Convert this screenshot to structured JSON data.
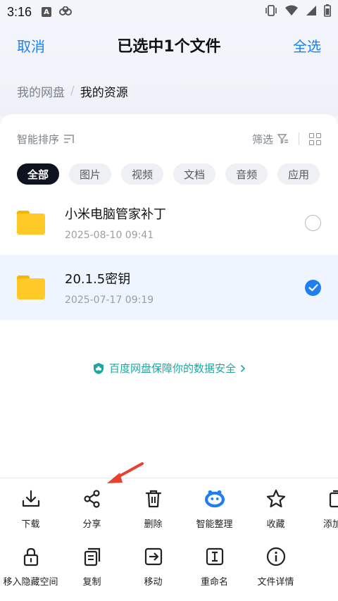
{
  "status": {
    "time": "3:16"
  },
  "header": {
    "cancel": "取消",
    "title": "已选中1个文件",
    "select_all": "全选"
  },
  "breadcrumb": {
    "root": "我的网盘",
    "separator": "/",
    "current": "我的资源"
  },
  "sort": {
    "label": "智能排序",
    "filter_label": "筛选"
  },
  "chips": [
    "全部",
    "图片",
    "视频",
    "文档",
    "音频",
    "应用"
  ],
  "files": [
    {
      "name": "小米电脑管家补丁",
      "date": "2025-08-10  09:41",
      "selected": false
    },
    {
      "name": "20.1.5密钥",
      "date": "2025-07-17  09:19",
      "selected": true
    }
  ],
  "security_tip": "百度网盘保障你的数据安全",
  "actions_row1": [
    "下载",
    "分享",
    "删除",
    "智能整理",
    "收藏",
    "添加到"
  ],
  "actions_row2": [
    "移入隐藏空间",
    "复制",
    "移动",
    "重命名",
    "文件详情"
  ],
  "colors": {
    "accent": "#1f7ff0",
    "folder": "#ffca28",
    "arrow": "#e5432d",
    "security": "#1ea7a0"
  }
}
